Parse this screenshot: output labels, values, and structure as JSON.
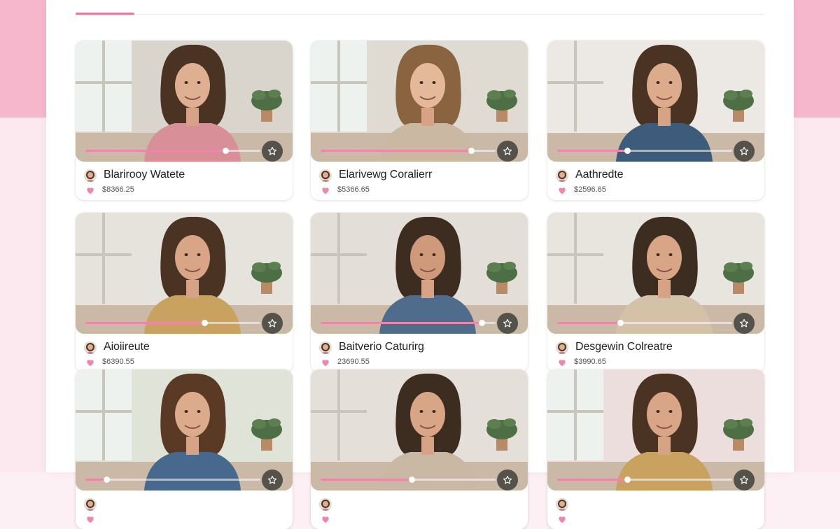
{
  "colors": {
    "accent": "#e7799e",
    "scrubber": "#ee86a9",
    "heart": "#ee86a9",
    "page_top": "#f6b6cb",
    "page_bottom": "#fbe9ef"
  },
  "tabs": {
    "active_index": 0
  },
  "videos": [
    {
      "name": "Blarirooy Watete",
      "price": "$8366.25",
      "progress": 0.8,
      "icon": "star-icon"
    },
    {
      "name": "Elarivewg Coralierr",
      "price": "$5366.65",
      "progress": 0.86,
      "icon": "star-icon"
    },
    {
      "name": "Aathredte",
      "price": "$2596.65",
      "progress": 0.4,
      "icon": "star-icon"
    },
    {
      "name": "Aioiireute",
      "price": "$6390.55",
      "progress": 0.68,
      "icon": "star-icon"
    },
    {
      "name": "Baitverio Caturirg",
      "price": "23690.55",
      "progress": 0.92,
      "icon": "star-icon"
    },
    {
      "name": "Desgewin Colreatre",
      "price": "$3990.65",
      "progress": 0.36,
      "icon": "star-icon"
    },
    {
      "name": "",
      "price": "",
      "progress": 0.12,
      "icon": "star-icon"
    },
    {
      "name": "",
      "price": "",
      "progress": 0.52,
      "icon": "star-icon"
    },
    {
      "name": "",
      "price": "",
      "progress": 0.4,
      "icon": "star-icon"
    }
  ]
}
